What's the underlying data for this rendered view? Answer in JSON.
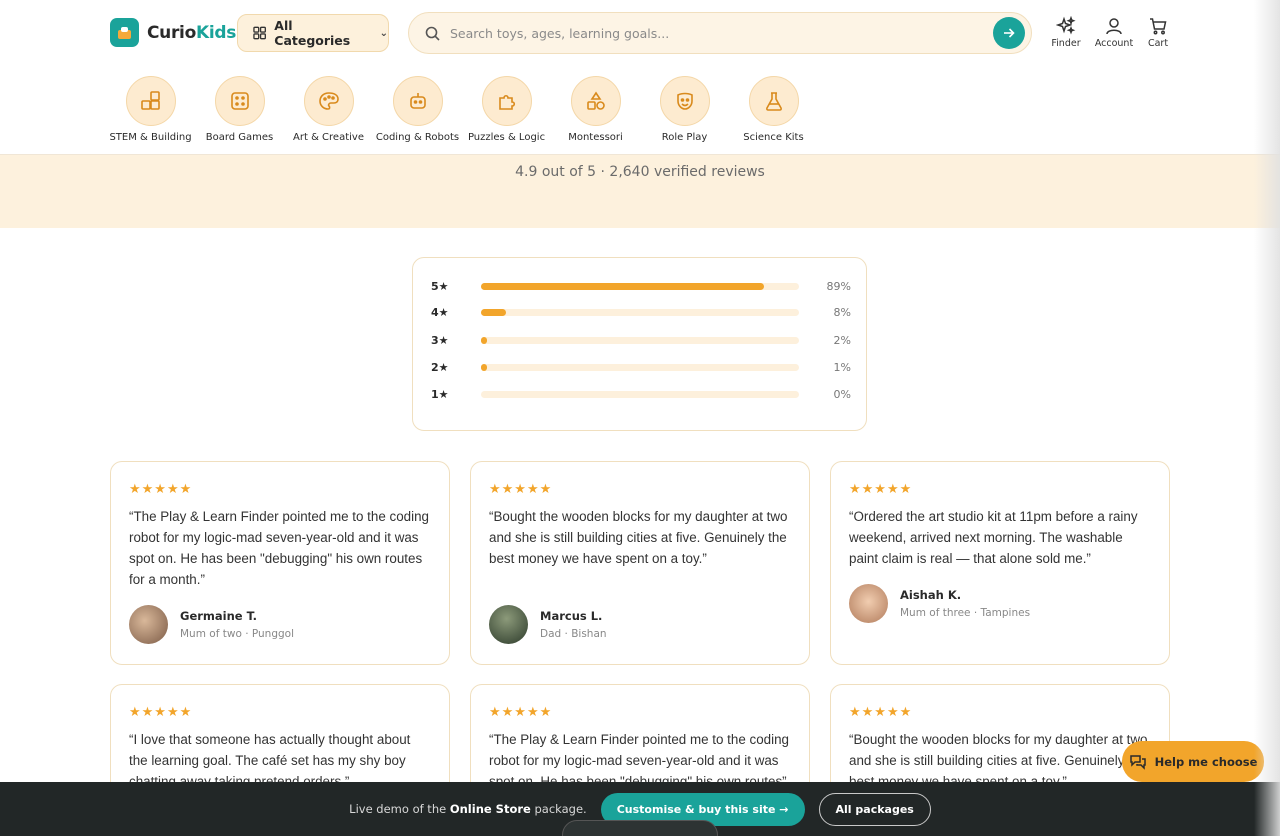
{
  "brand": {
    "name_part1": "Curio",
    "name_part2": "Kids",
    "accent": "#1aa39a",
    "warm": "#f2a52b"
  },
  "header": {
    "categories_label": "All Categories",
    "search_placeholder": "Search toys, ages, learning goals...",
    "icons": [
      {
        "name": "finder-icon",
        "label": "Finder"
      },
      {
        "name": "account-icon",
        "label": "Account"
      },
      {
        "name": "cart-icon",
        "label": "Cart"
      }
    ]
  },
  "categories": [
    {
      "label": "STEM & Building",
      "icon": "blocks-icon"
    },
    {
      "label": "Board Games",
      "icon": "dice-icon"
    },
    {
      "label": "Art & Creative",
      "icon": "palette-icon"
    },
    {
      "label": "Coding & Robots",
      "icon": "robot-icon"
    },
    {
      "label": "Puzzles & Logic",
      "icon": "puzzle-icon"
    },
    {
      "label": "Montessori",
      "icon": "shapes-icon"
    },
    {
      "label": "Role Play",
      "icon": "mask-icon"
    },
    {
      "label": "Science Kits",
      "icon": "flask-icon"
    }
  ],
  "summary": {
    "text": "4.9 out of 5 · 2,640 verified reviews"
  },
  "rating_breakdown": [
    {
      "stars": "5★",
      "percent_label": "89%",
      "percent": 89
    },
    {
      "stars": "4★",
      "percent_label": "8%",
      "percent": 8
    },
    {
      "stars": "3★",
      "percent_label": "2%",
      "percent": 2
    },
    {
      "stars": "2★",
      "percent_label": "1%",
      "percent": 1
    },
    {
      "stars": "1★",
      "percent_label": "0%",
      "percent": 0
    }
  ],
  "reviews": [
    {
      "stars": "★★★★★",
      "quote": "“The Play & Learn Finder pointed me to the coding robot for my logic-mad seven-year-old and it was spot on. He has been \"debugging\" his own routes for a month.”",
      "name": "Germaine T.",
      "meta": "Mum of two · Punggol"
    },
    {
      "stars": "★★★★★",
      "quote": "“Bought the wooden blocks for my daughter at two and she is still building cities at five. Genuinely the best money we have spent on a toy.”",
      "name": "Marcus L.",
      "meta": "Dad · Bishan"
    },
    {
      "stars": "★★★★★",
      "quote": "“Ordered the art studio kit at 11pm before a rainy weekend, arrived next morning. The washable paint claim is real — that alone sold me.”",
      "name": "Aishah K.",
      "meta": "Mum of three · Tampines"
    },
    {
      "stars": "★★★★★",
      "quote": "“I love that someone has actually thought about the learning goal. The café set has my shy boy chatting away taking pretend orders.”"
    },
    {
      "stars": "★★★★★",
      "quote": "“The Play & Learn Finder pointed me to the coding robot for my logic-mad seven-year-old and it was spot on. He has been \"debugging\" his own routes”"
    },
    {
      "stars": "★★★★★",
      "quote": "“Bought the wooden blocks for my daughter at two and she is still building cities at five. Genuinely the best money we have spent on a toy.”"
    }
  ],
  "help": {
    "label": "Help me choose"
  },
  "demo_bar": {
    "text_prefix": "Live demo of the",
    "package": "Online Store",
    "text_suffix": "package.",
    "primary": "Customise & buy this site →",
    "secondary": "All packages"
  }
}
